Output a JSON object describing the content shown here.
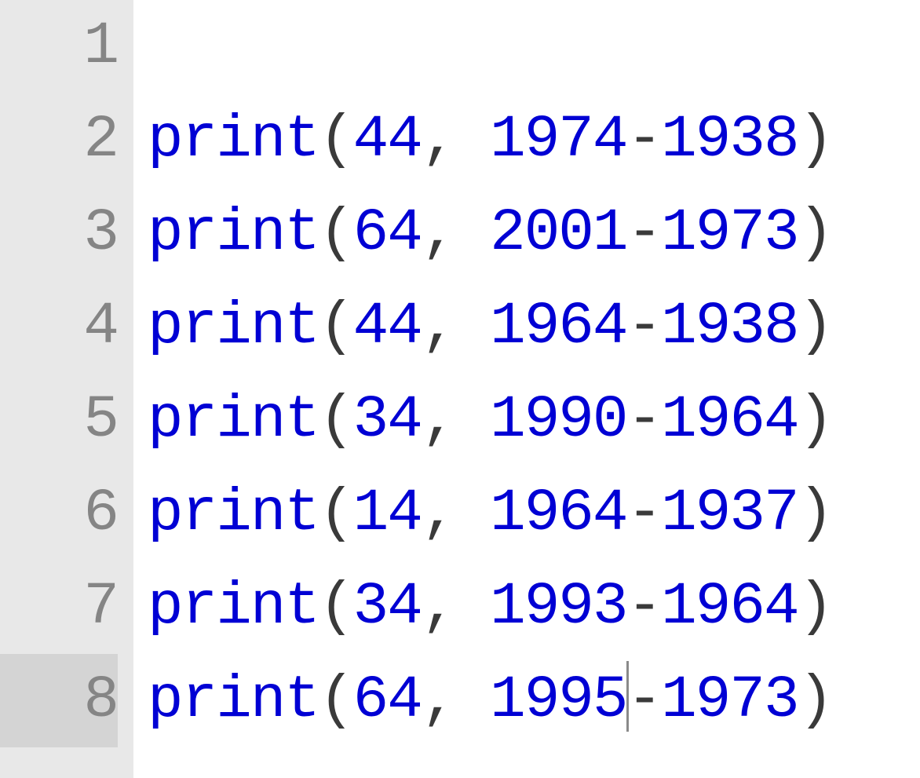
{
  "editor": {
    "currentLine": 8,
    "cursorAfterToken": 5,
    "lines": [
      {
        "number": "1",
        "tokens": []
      },
      {
        "number": "2",
        "tokens": [
          {
            "t": "print",
            "c": "fn"
          },
          {
            "t": "(",
            "c": "punct"
          },
          {
            "t": "44",
            "c": "num"
          },
          {
            "t": ", ",
            "c": "punct"
          },
          {
            "t": "1974",
            "c": "num"
          },
          {
            "t": "-",
            "c": "op"
          },
          {
            "t": "1938",
            "c": "num"
          },
          {
            "t": ")",
            "c": "punct"
          }
        ]
      },
      {
        "number": "3",
        "tokens": [
          {
            "t": "print",
            "c": "fn"
          },
          {
            "t": "(",
            "c": "punct"
          },
          {
            "t": "64",
            "c": "num"
          },
          {
            "t": ", ",
            "c": "punct"
          },
          {
            "t": "2001",
            "c": "num"
          },
          {
            "t": "-",
            "c": "op"
          },
          {
            "t": "1973",
            "c": "num"
          },
          {
            "t": ")",
            "c": "punct"
          }
        ]
      },
      {
        "number": "4",
        "tokens": [
          {
            "t": "print",
            "c": "fn"
          },
          {
            "t": "(",
            "c": "punct"
          },
          {
            "t": "44",
            "c": "num"
          },
          {
            "t": ", ",
            "c": "punct"
          },
          {
            "t": "1964",
            "c": "num"
          },
          {
            "t": "-",
            "c": "op"
          },
          {
            "t": "1938",
            "c": "num"
          },
          {
            "t": ")",
            "c": "punct"
          }
        ]
      },
      {
        "number": "5",
        "tokens": [
          {
            "t": "print",
            "c": "fn"
          },
          {
            "t": "(",
            "c": "punct"
          },
          {
            "t": "34",
            "c": "num"
          },
          {
            "t": ", ",
            "c": "punct"
          },
          {
            "t": "1990",
            "c": "num"
          },
          {
            "t": "-",
            "c": "op"
          },
          {
            "t": "1964",
            "c": "num"
          },
          {
            "t": ")",
            "c": "punct"
          }
        ]
      },
      {
        "number": "6",
        "tokens": [
          {
            "t": "print",
            "c": "fn"
          },
          {
            "t": "(",
            "c": "punct"
          },
          {
            "t": "14",
            "c": "num"
          },
          {
            "t": ", ",
            "c": "punct"
          },
          {
            "t": "1964",
            "c": "num"
          },
          {
            "t": "-",
            "c": "op"
          },
          {
            "t": "1937",
            "c": "num"
          },
          {
            "t": ")",
            "c": "punct"
          }
        ]
      },
      {
        "number": "7",
        "tokens": [
          {
            "t": "print",
            "c": "fn"
          },
          {
            "t": "(",
            "c": "punct"
          },
          {
            "t": "34",
            "c": "num"
          },
          {
            "t": ", ",
            "c": "punct"
          },
          {
            "t": "1993",
            "c": "num"
          },
          {
            "t": "-",
            "c": "op"
          },
          {
            "t": "1964",
            "c": "num"
          },
          {
            "t": ")",
            "c": "punct"
          }
        ]
      },
      {
        "number": "8",
        "tokens": [
          {
            "t": "print",
            "c": "fn"
          },
          {
            "t": "(",
            "c": "punct"
          },
          {
            "t": "64",
            "c": "num"
          },
          {
            "t": ", ",
            "c": "punct"
          },
          {
            "t": "1995",
            "c": "num"
          },
          {
            "t": "-",
            "c": "op"
          },
          {
            "t": "1973",
            "c": "num"
          },
          {
            "t": ")",
            "c": "punct"
          }
        ]
      }
    ]
  }
}
